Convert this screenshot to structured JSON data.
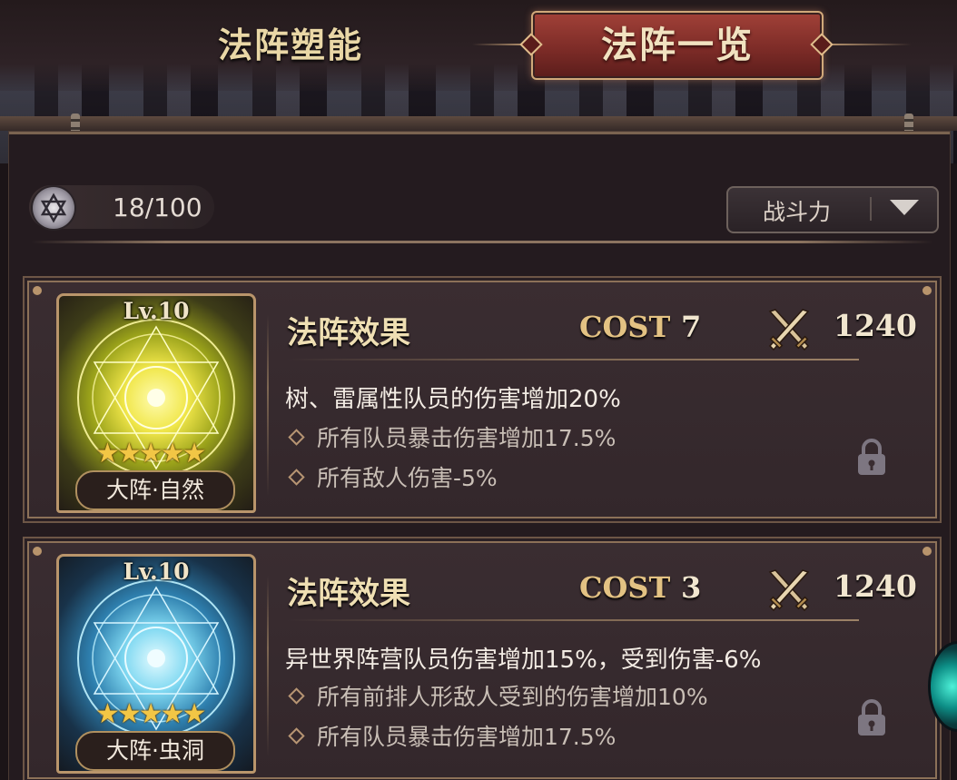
{
  "tabs": {
    "left_label": "法阵塑能",
    "active_label": "法阵一览"
  },
  "counter": {
    "text": "18/100",
    "icon": "hexagram-icon"
  },
  "sort": {
    "label": "战斗力",
    "icon": "triangle-down-icon"
  },
  "cards": [
    {
      "level": "Lv.10",
      "stars": "★★★★★",
      "name": "大阵·自然",
      "art_color": "#e8e44a",
      "effect_title": "法阵效果",
      "cost_label": "COST",
      "cost": "7",
      "power": "1240",
      "main_effect": "树、雷属性队员的伤害增加20%",
      "sub_effects": [
        "所有队员暴击伤害增加17.5%",
        "所有敌人伤害-5%"
      ],
      "icons": [
        "crossed-swords-icon",
        "lock-icon"
      ]
    },
    {
      "level": "Lv.10",
      "stars": "★★★★★",
      "name": "大阵·虫洞",
      "art_color": "#6fd2f0",
      "effect_title": "法阵效果",
      "cost_label": "COST",
      "cost": "3",
      "power": "1240",
      "main_effect": "异世界阵营队员伤害增加15%，受到伤害-6%",
      "sub_effects": [
        "所有前排人形敌人受到的伤害增加10%",
        "所有队员暴击伤害增加17.5%"
      ],
      "icons": [
        "crossed-swords-icon",
        "lock-icon"
      ]
    }
  ]
}
